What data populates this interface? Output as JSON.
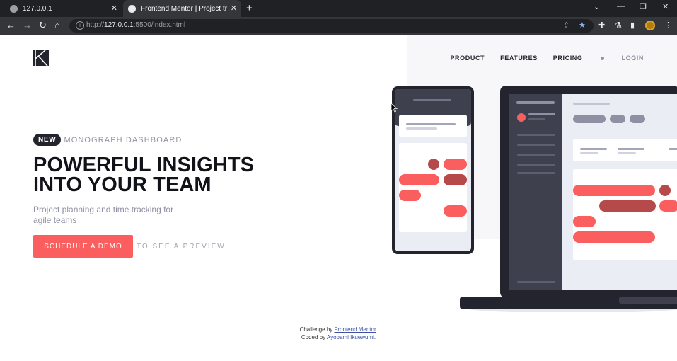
{
  "browser": {
    "tabs": [
      {
        "title": "127.0.0.1",
        "close": "✕"
      },
      {
        "title": "Frontend Mentor | Project tracking intro component",
        "close": "✕"
      }
    ],
    "new_tab": "+",
    "url_prefix": "http://",
    "url_host": "127.0.0.1",
    "url_rest": ":5500/index.html"
  },
  "nav": {
    "items": [
      "PRODUCT",
      "FEATURES",
      "PRICING"
    ],
    "login": "LOGIN"
  },
  "hero": {
    "badge": "NEW",
    "eyebrow": "MONOGRAPH DASHBOARD",
    "title_line1": "POWERFUL INSIGHTS",
    "title_line2": "INTO YOUR TEAM",
    "subtitle": "Project planning and time tracking for agile teams",
    "cta": "SCHEDULE A DEMO",
    "preview": "TO SEE A PREVIEW"
  },
  "footer": {
    "challenge_prefix": "Challenge by",
    "challenge_link": "Frontend Mentor",
    "coded_prefix": "Coded by",
    "coded_link": "Ayobami Ikuewumi",
    "period": "."
  },
  "colors": {
    "accent": "#fb5e5e",
    "accent_dark": "#b64949",
    "dark": "#24242f",
    "muted": "#8f90a3",
    "light_bg": "#f7f7f9"
  }
}
